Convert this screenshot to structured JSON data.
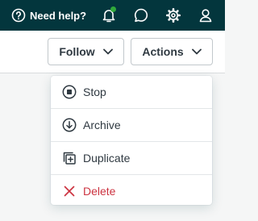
{
  "topbar": {
    "help_label": "Need help?",
    "notification_badge_color": "#30aa3b",
    "background_color": "#03363d"
  },
  "header": {
    "follow_label": "Follow",
    "actions_label": "Actions"
  },
  "menu": {
    "items": [
      {
        "label": "Stop",
        "icon": "stop-circle-icon"
      },
      {
        "label": "Archive",
        "icon": "archive-down-icon"
      },
      {
        "label": "Duplicate",
        "icon": "duplicate-icon"
      },
      {
        "label": "Delete",
        "icon": "x-icon",
        "color": "#cc3340"
      }
    ]
  }
}
